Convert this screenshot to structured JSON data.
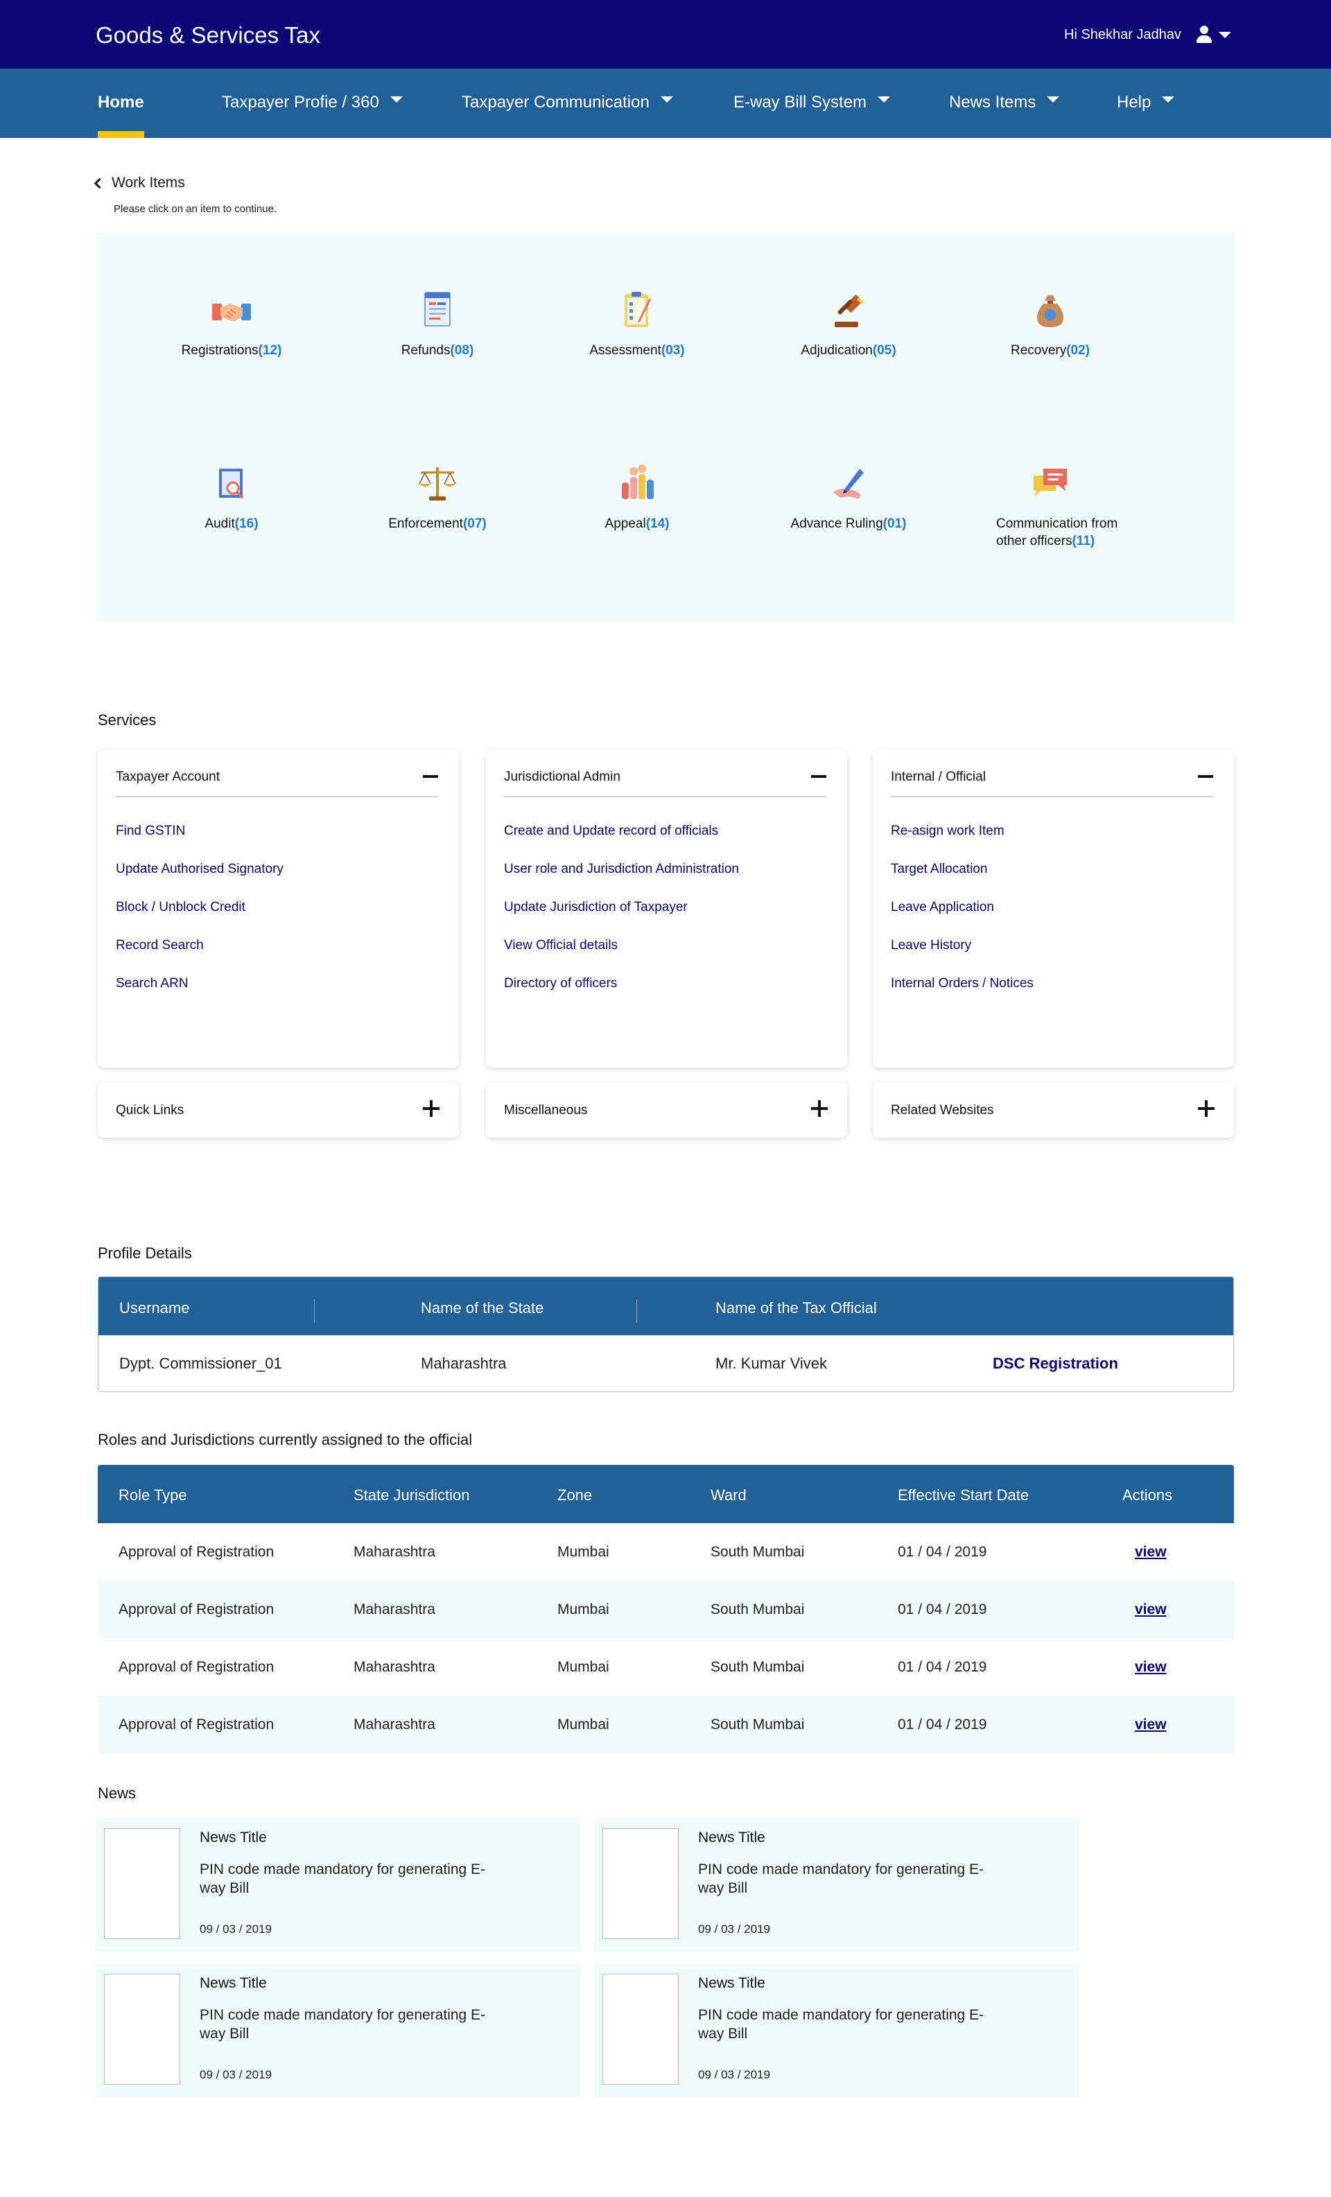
{
  "header": {
    "app_title": "Goods & Services Tax",
    "greeting": "Hi Shekhar Jadhav"
  },
  "nav": {
    "items": [
      {
        "label": "Home",
        "active": true
      },
      {
        "label": "Taxpayer Profie / 360"
      },
      {
        "label": "Taxpayer Communication"
      },
      {
        "label": "E-way Bill System"
      },
      {
        "label": "News Items"
      },
      {
        "label": "Help"
      }
    ]
  },
  "work_items": {
    "title": "Work Items",
    "subtitle": "Please click on an item to continue.",
    "items": [
      {
        "label": "Registrations",
        "count": "(12)",
        "icon": "handshake-icon"
      },
      {
        "label": "Refunds",
        "count": "(08)",
        "icon": "refund-document-icon"
      },
      {
        "label": "Assessment",
        "count": "(03)",
        "icon": "clipboard-checklist-icon"
      },
      {
        "label": "Adjudication",
        "count": "(05)",
        "icon": "gavel-icon"
      },
      {
        "label": "Recovery",
        "count": "(02)",
        "icon": "money-bag-icon"
      },
      {
        "label": "Audit",
        "count": "(16)",
        "icon": "audit-magnifier-icon"
      },
      {
        "label": "Enforcement",
        "count": "(07)",
        "icon": "scales-icon"
      },
      {
        "label": "Appeal",
        "count": "(14)",
        "icon": "raised-hands-icon"
      },
      {
        "label": "Advance Ruling",
        "count": "(01)",
        "icon": "pen-writing-icon"
      },
      {
        "label": "Communication from other officers",
        "label_line1": "Communication from",
        "label_line2": "other officers",
        "count": "(11)",
        "icon": "chat-bubbles-icon"
      }
    ]
  },
  "services": {
    "title": "Services",
    "cards": [
      {
        "title": "Taxpayer Account",
        "links": [
          "Find GSTIN",
          "Update Authorised Signatory",
          "Block / Unblock Credit",
          "Record Search",
          "Search ARN"
        ]
      },
      {
        "title": "Jurisdictional Admin",
        "links": [
          "Create and Update record of officials",
          "User role and Jurisdiction Administration",
          "Update Jurisdiction of Taxpayer",
          "View Official details",
          "Directory of officers"
        ]
      },
      {
        "title": "Internal / Official",
        "links": [
          "Re-asign work Item",
          "Target Allocation",
          "Leave Application",
          "Leave History",
          "Internal Orders / Notices"
        ]
      }
    ],
    "collapsed": [
      "Quick Links",
      "Miscellaneous",
      "Related Websites"
    ]
  },
  "profile": {
    "title": "Profile Details",
    "headers": [
      "Username",
      "Name of the State",
      "Name of the Tax Official"
    ],
    "row": {
      "username": "Dypt. Commissioner_01",
      "state": "Maharashtra",
      "official": "Mr. Kumar Vivek",
      "action": "DSC Registration"
    }
  },
  "roles": {
    "title": "Roles and Jurisdictions currently assigned to the official",
    "headers": [
      "Role Type",
      "State Jurisdiction",
      "Zone",
      "Ward",
      "Effective Start Date",
      "Actions"
    ],
    "rows": [
      [
        "Approval of Registration",
        "Maharashtra",
        "Mumbai",
        "South Mumbai",
        "01 / 04 / 2019",
        "view"
      ],
      [
        "Approval of Registration",
        "Maharashtra",
        "Mumbai",
        "South Mumbai",
        "01 / 04 / 2019",
        "view"
      ],
      [
        "Approval of Registration",
        "Maharashtra",
        "Mumbai",
        "South Mumbai",
        "01 / 04 / 2019",
        "view"
      ],
      [
        "Approval of Registration",
        "Maharashtra",
        "Mumbai",
        "South Mumbai",
        "01 / 04 / 2019",
        "view"
      ]
    ]
  },
  "news": {
    "title": "News",
    "items": [
      {
        "title": "News Title",
        "desc": "PIN code made mandatory for generating E-way Bill",
        "date": "09 / 03 / 2019"
      },
      {
        "title": "News Title",
        "desc": "PIN code made mandatory for generating E-way Bill",
        "date": "09 / 03 / 2019"
      },
      {
        "title": "News Title",
        "desc": "PIN code made mandatory for generating E-way Bill",
        "date": "09 / 03 / 2019"
      },
      {
        "title": "News Title",
        "desc": "PIN code made mandatory for generating E-way Bill",
        "date": "09 / 03 / 2019"
      }
    ]
  },
  "colors": {
    "top_bar": "#0c0777",
    "nav_bar": "#216198",
    "nav_active_underline": "#f5c400",
    "count_blue": "#1f7ad6",
    "link_navy": "#0c0777",
    "panel_mint": "#effaf9"
  }
}
